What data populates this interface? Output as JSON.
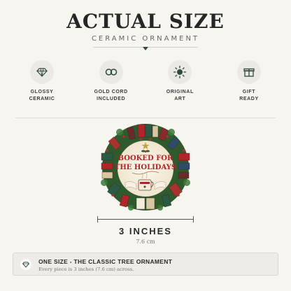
{
  "header": {
    "title": "ACTUAL SIZE",
    "subtitle": "CERAMIC ORNAMENT"
  },
  "features": [
    {
      "icon": "diamond-icon",
      "label": "GLOSSY\nCERAMIC"
    },
    {
      "icon": "rings-icon",
      "label": "GOLD CORD\nINCLUDED"
    },
    {
      "icon": "sun-icon",
      "label": "ORIGINAL\nART"
    },
    {
      "icon": "gift-icon",
      "label": "GIFT\nREADY"
    }
  ],
  "ornament": {
    "text_line1": "BOOKED FOR",
    "text_line2": "THE HOLIDAYS",
    "colors": {
      "red": "#b2232a",
      "green": "#2f5a2e",
      "cream": "#f3ecdc"
    }
  },
  "measurement": {
    "label": "3 INCHES",
    "sublabel": "7.6 cm"
  },
  "info": {
    "icon": "diamond-icon",
    "title": "ONE SIZE - THE CLASSIC TREE ORNAMENT",
    "description": "Every piece is 3 inches (7.6 cm) across."
  },
  "colors": {
    "background": "#f7f5f0",
    "accent": "#2f4b3a"
  }
}
